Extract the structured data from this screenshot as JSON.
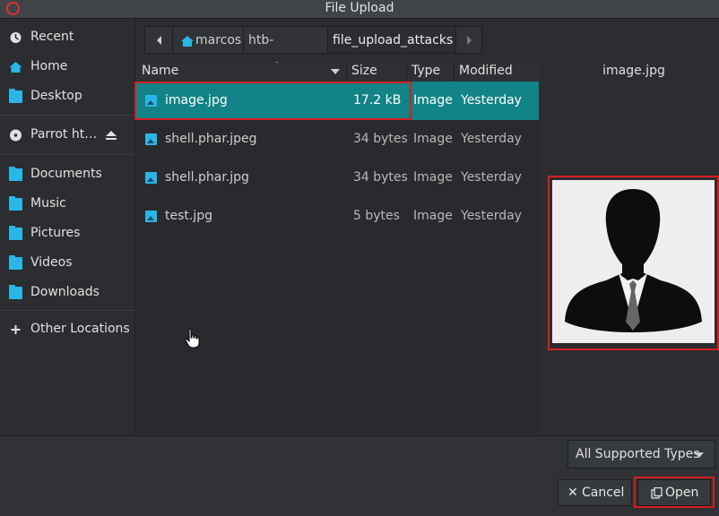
{
  "window": {
    "title": "File Upload"
  },
  "sidebar": {
    "items": [
      {
        "label": "Recent",
        "icon": "clock-icon"
      },
      {
        "label": "Home",
        "icon": "home-icon"
      },
      {
        "label": "Desktop",
        "icon": "folder-icon"
      },
      {
        "label": "Parrot ht…",
        "icon": "disc-icon"
      },
      {
        "label": "Documents",
        "icon": "folder-icon"
      },
      {
        "label": "Music",
        "icon": "folder-icon"
      },
      {
        "label": "Pictures",
        "icon": "folder-icon"
      },
      {
        "label": "Videos",
        "icon": "folder-icon"
      },
      {
        "label": "Downloads",
        "icon": "folder-icon"
      },
      {
        "label": "Other Locations",
        "icon": "plus-icon"
      }
    ]
  },
  "pathbar": {
    "crumbs": [
      "marcos",
      "htb-academy",
      "file_upload_attacks"
    ]
  },
  "columns": {
    "name": "Name",
    "size": "Size",
    "type": "Type",
    "modified": "Modified"
  },
  "files": [
    {
      "name": "image.jpg",
      "size": "17.2 kB",
      "type": "Image",
      "modified": "Yesterday"
    },
    {
      "name": "shell.phar.jpeg",
      "size": "34 bytes",
      "type": "Image",
      "modified": "Yesterday"
    },
    {
      "name": "shell.phar.jpg",
      "size": "34 bytes",
      "type": "Image",
      "modified": "Yesterday"
    },
    {
      "name": "test.jpg",
      "size": "5 bytes",
      "type": "Image",
      "modified": "Yesterday"
    }
  ],
  "preview": {
    "filename": "image.jpg"
  },
  "footer": {
    "filter_label": "All Supported Types",
    "cancel_label": "Cancel",
    "open_label": "Open"
  },
  "colors": {
    "selection": "#128386",
    "accent": "#2ab6e6",
    "highlight": "#d61d22"
  }
}
